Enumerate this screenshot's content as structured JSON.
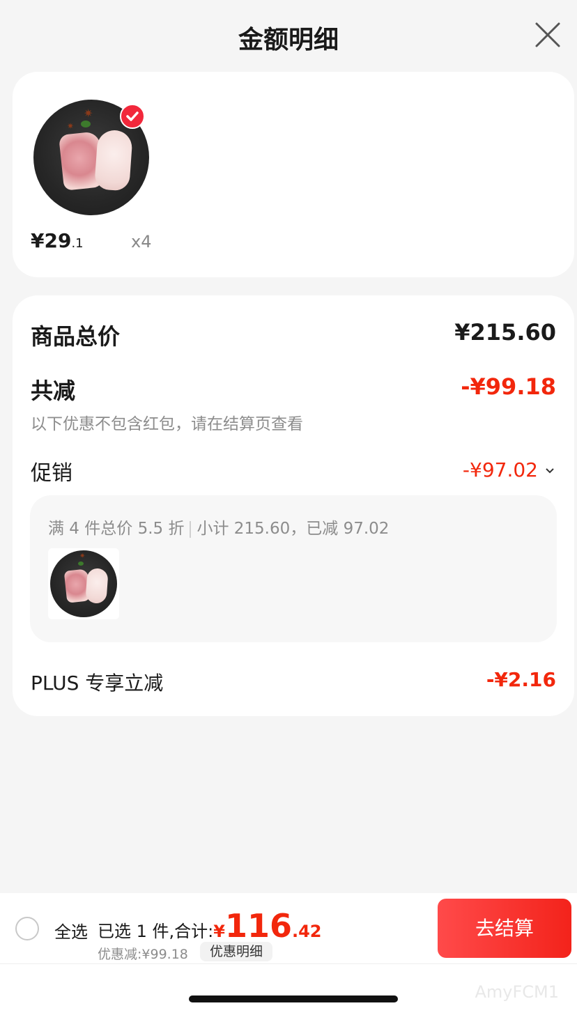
{
  "header": {
    "title": "金额明细"
  },
  "product": {
    "price_int": "¥29",
    "price_dec": ".1",
    "quantity": "x4"
  },
  "summary": {
    "total_label": "商品总价",
    "total_value": "¥215.60",
    "reduce_label": "共减",
    "reduce_value": "-¥99.18",
    "note": "以下优惠不包含红包，请在结算页查看",
    "promo_label": "促销",
    "promo_value": "-¥97.02",
    "promo_rule": "满 4 件总价 5.5 折",
    "promo_subtotal": "小计 215.60，已减 97.02",
    "plus_label": "PLUS 专享立减",
    "plus_value": "-¥2.16"
  },
  "footer": {
    "select_all": "全选",
    "selected_text": "已选 1 件,合计:",
    "total_yen": "¥",
    "total_int": "116",
    "total_dec": ".42",
    "discount": "优惠减:¥99.18",
    "detail_button": "优惠明细",
    "checkout_button": "去结算"
  },
  "watermark": "AmyFCM1",
  "colors": {
    "accent": "#f2270c",
    "background": "#f5f5f5",
    "card": "#ffffff"
  }
}
